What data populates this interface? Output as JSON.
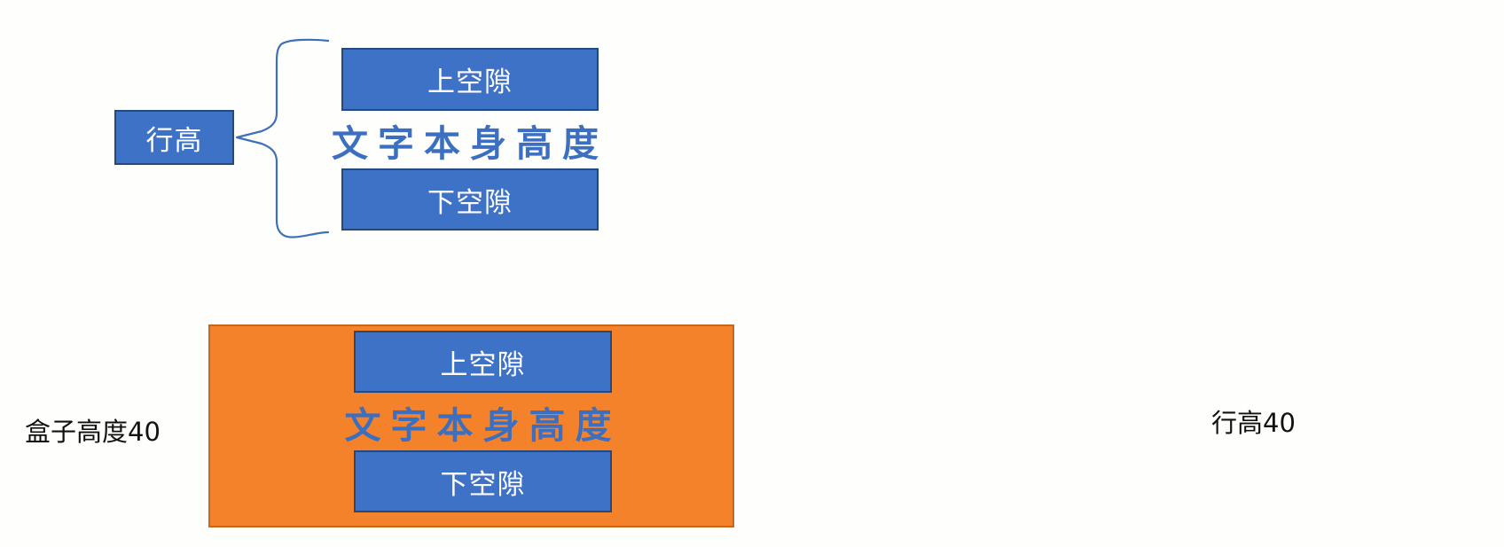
{
  "top_diagram": {
    "line_height_label": "行高",
    "upper_gap_label": "上空隙",
    "text_height_label": "文字本身高度",
    "lower_gap_label": "下空隙"
  },
  "bottom_diagram": {
    "box_height_label": "盒子高度40",
    "upper_gap_label": "上空隙",
    "text_height_label": "文字本身高度",
    "lower_gap_label": "下空隙",
    "line_height_label": "行高40"
  },
  "colors": {
    "box_blue": "#3d72c6",
    "box_border": "#24497f",
    "text_blue": "#3d6fc0",
    "orange": "#f4822a",
    "background": "#fefefc"
  }
}
